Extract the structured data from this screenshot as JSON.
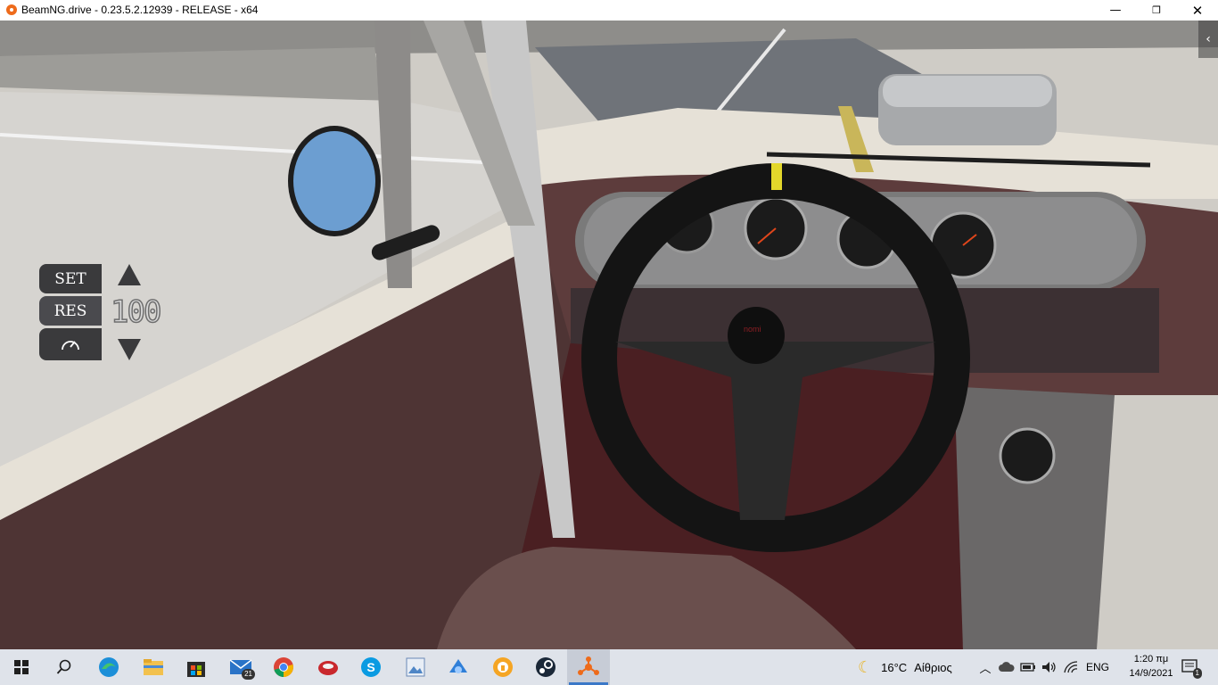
{
  "window": {
    "title": "BeamNG.drive - 0.23.5.2.12939 - RELEASE - x64",
    "minimize_icon": "minimize-icon",
    "maximize_icon": "restore-icon",
    "close_icon": "close-icon"
  },
  "hud": {
    "cruise_control": {
      "set_label": "SET",
      "res_label": "RES",
      "speed": "100",
      "gauge_icon": "speedometer-icon",
      "up_icon": "arrow-up-icon",
      "down_icon": "arrow-down-icon"
    },
    "collapse_icon": "chevron-left-icon",
    "steering_wheel_logo": "nomi"
  },
  "taskbar": {
    "apps": [
      {
        "name": "start",
        "icon": "windows-start-icon"
      },
      {
        "name": "search",
        "icon": "search-icon"
      },
      {
        "name": "edge",
        "icon": "edge-icon"
      },
      {
        "name": "file-explorer",
        "icon": "folder-icon"
      },
      {
        "name": "store",
        "icon": "store-icon"
      },
      {
        "name": "mail",
        "icon": "mail-icon",
        "badge": "21"
      },
      {
        "name": "chrome",
        "icon": "chrome-icon"
      },
      {
        "name": "app-red",
        "icon": "red-app-icon"
      },
      {
        "name": "skype",
        "icon": "skype-icon"
      },
      {
        "name": "photos",
        "icon": "photos-icon"
      },
      {
        "name": "app-blue",
        "icon": "blue-app-icon"
      },
      {
        "name": "app-orange",
        "icon": "orange-app-icon"
      },
      {
        "name": "steam",
        "icon": "steam-icon"
      },
      {
        "name": "beamng",
        "icon": "beamng-icon",
        "active": true
      }
    ],
    "weather": {
      "icon": "moon-icon",
      "temp": "16°C",
      "condition": "Αίθριος"
    },
    "tray": {
      "chevron_icon": "chevron-up-icon",
      "onedrive_icon": "cloud-icon",
      "battery_icon": "battery-icon",
      "volume_icon": "volume-icon",
      "network_icon": "wifi-icon",
      "language": "ENG"
    },
    "clock": {
      "time": "1:20 πμ",
      "date": "14/9/2021"
    },
    "notifications": {
      "icon": "notification-icon",
      "count": "1"
    }
  },
  "colors": {
    "accent": "#3b78c8",
    "taskbar_bg": "#dfe3ea",
    "interior": "#5a3b3b",
    "carpet": "#4a1f22"
  }
}
